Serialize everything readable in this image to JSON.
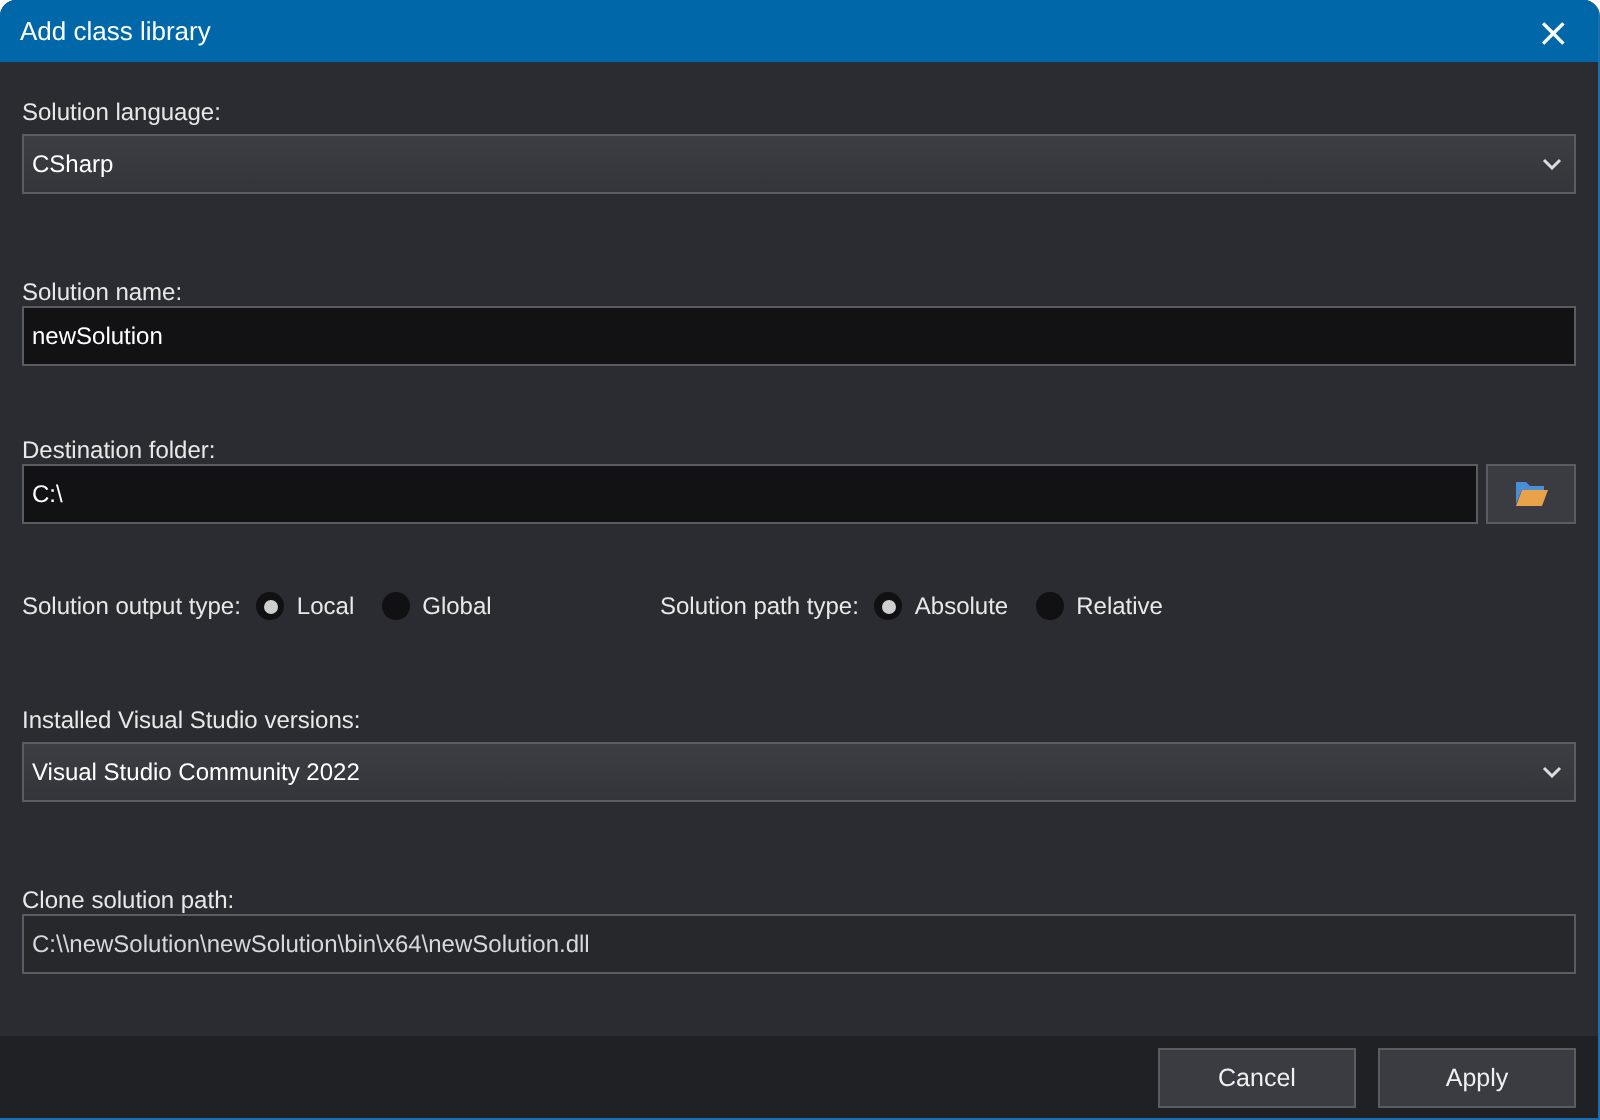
{
  "window": {
    "title": "Add class library",
    "close": "×"
  },
  "language": {
    "label": "Solution language:",
    "value": "CSharp"
  },
  "name": {
    "label": "Solution name:",
    "value": "newSolution"
  },
  "destination": {
    "label": "Destination folder:",
    "value": "C:\\"
  },
  "radio_groups": [
    {
      "label": "Solution output type:",
      "options": [
        {
          "label": "Local",
          "selected": true
        },
        {
          "label": "Global",
          "selected": false
        }
      ]
    },
    {
      "label": "Solution path type:",
      "options": [
        {
          "label": "Absolute",
          "selected": true
        },
        {
          "label": "Relative",
          "selected": false
        }
      ]
    }
  ],
  "vs_versions": {
    "label": "Installed Visual Studio versions:",
    "value": "Visual Studio Community 2022"
  },
  "clone_path": {
    "label": "Clone solution path:",
    "value": "C:\\\\newSolution\\newSolution\\bin\\x64\\newSolution.dll"
  },
  "buttons": [
    "Cancel",
    "Apply"
  ]
}
